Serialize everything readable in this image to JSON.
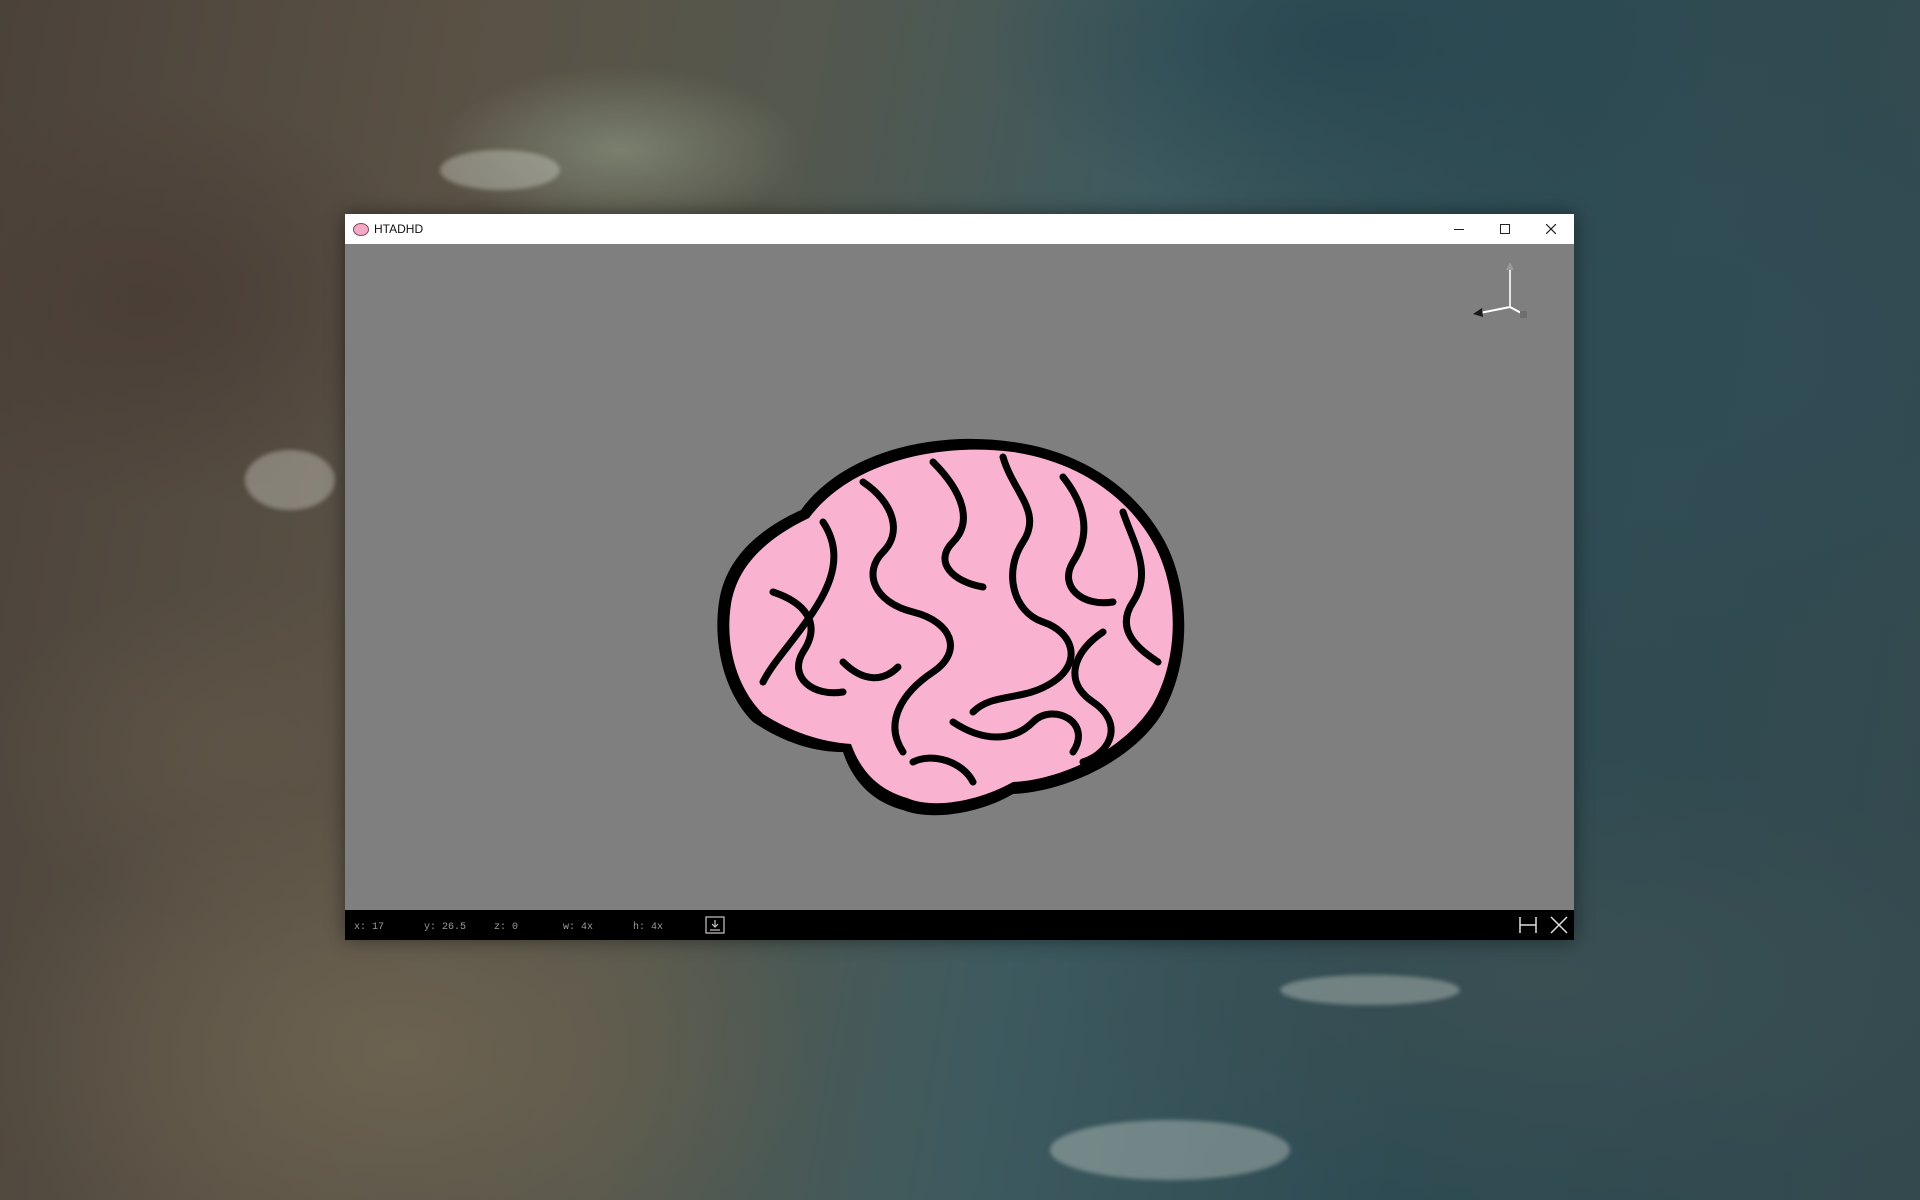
{
  "window": {
    "title": "HTADHD",
    "app_icon": "brain-icon",
    "controls": [
      "minimize-icon",
      "maximize-icon",
      "close-icon"
    ]
  },
  "viewport": {
    "background": "#7f7f7f",
    "model": "brain",
    "model_color": "#f9b2cf",
    "gizmo": "axis-gizmo-icon"
  },
  "statusbar": {
    "x": "x: 17",
    "y": "y: 26.5",
    "z": "z: 0",
    "w": "w: 4x",
    "h": "h: 4x",
    "icons": [
      "save-icon",
      "h-icon",
      "x-icon"
    ]
  },
  "colors": {
    "brain_fill": "#f9b2cf",
    "brain_outline": "#000000",
    "viewport_bg": "#7f7f7f",
    "statusbar_bg": "#000000",
    "statusbar_text": "#9a9a9a"
  }
}
